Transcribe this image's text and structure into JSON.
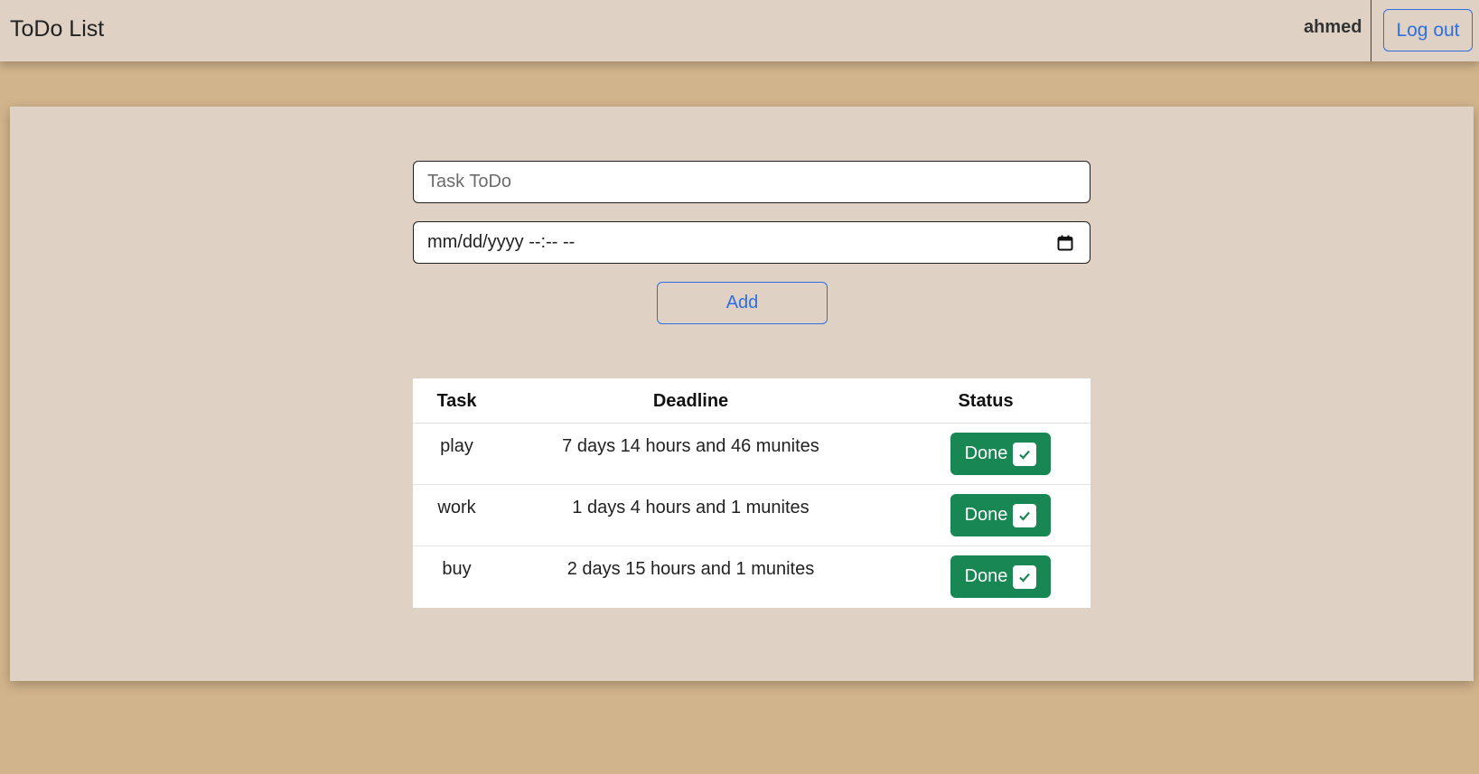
{
  "navbar": {
    "brand": "ToDo List",
    "username": "ahmed",
    "logout_label": "Log out"
  },
  "form": {
    "task_placeholder": "Task ToDo",
    "date_placeholder": "mm/dd/yyyy --:-- --",
    "add_label": "Add"
  },
  "table": {
    "headers": {
      "task": "Task",
      "deadline": "Deadline",
      "status": "Status"
    },
    "rows": [
      {
        "task": "play",
        "deadline": "7 days 14 hours and 46 munites",
        "status": "Done"
      },
      {
        "task": "work",
        "deadline": "1 days 4 hours and 1 munites",
        "status": "Done"
      },
      {
        "task": "buy",
        "deadline": "2 days 15 hours and 1 munites",
        "status": "Done"
      }
    ]
  },
  "colors": {
    "background": "#d2b48c",
    "panel": "#dfd1c4",
    "accent": "#2f6fe0",
    "done_green": "#198754"
  },
  "icons": {
    "date": "calendar-icon",
    "done": "checkmark-icon"
  }
}
